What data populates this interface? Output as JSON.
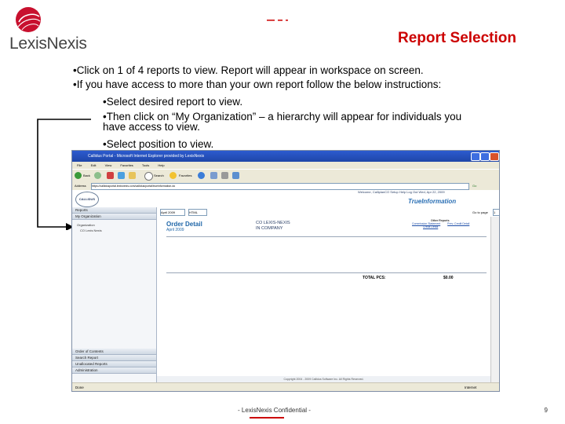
{
  "slide": {
    "logo_text": "LexisNexis",
    "title": "Report Selection",
    "bullets": [
      "•Click on 1 of 4 reports to view. Report will appear in workspace on screen.",
      "•If you have access to more than your own report follow the below instructions:",
      "•Select desired report to view.",
      "•Then click on “My Organization” – a hierarchy will appear for individuals you have access to view.",
      "•Select position to view."
    ],
    "footer_text": "- LexisNexis Confidential -",
    "page_number": "9"
  },
  "browser": {
    "title": "Callidus Portal - Microsoft Internet Explorer provided by LexisNexis",
    "menu": [
      "File",
      "Edit",
      "View",
      "Favorites",
      "Tools",
      "Help"
    ],
    "toolbar": {
      "back": "Back",
      "search": "Search",
      "favorites": "Favorites"
    },
    "address_label": "Address",
    "address_value": "https://callidusportal.lexisnexis.com/callidus/portal/trueinformation.do",
    "go_label": "Go",
    "status_left": "Done",
    "status_right": "Internet",
    "app": {
      "brand": "CALLIDUS",
      "welcome": "Welcome, CalliplanCO   Setup   Help   Log Out   Wed, Apr 22, 2009",
      "product": "TrueInformation",
      "sidebar": {
        "reports_header": "Reports",
        "my_org_header": "My Organization",
        "tree": [
          "Organization",
          "CO Lexis Nexis"
        ],
        "bottom_headers": [
          "Order of Contents",
          "Search Report",
          "Unallocated Reports",
          "Administration"
        ]
      },
      "controls": {
        "period": "April 2009",
        "type": "HTML",
        "page_label": "Go to page",
        "page_value": "1",
        "page_of": "of 1"
      },
      "report": {
        "title": "Order Detail",
        "date": "April 2009",
        "company": [
          "CO LEXIS-NEXIS",
          "IN COMPANY"
        ],
        "links_header": "Other Reports",
        "links": [
          "Commission Statement",
          "Prev. Credit Detail",
          "Credit Detail"
        ],
        "total_label": "TOTAL PCS:",
        "total_value": "$0.00",
        "copyright": "Copyright 2004 - 2009 Callidus Software Inc. All Rights Reserved."
      }
    }
  },
  "colors": {
    "title_red": "#cc0000",
    "report_blue": "#1f66a8"
  }
}
